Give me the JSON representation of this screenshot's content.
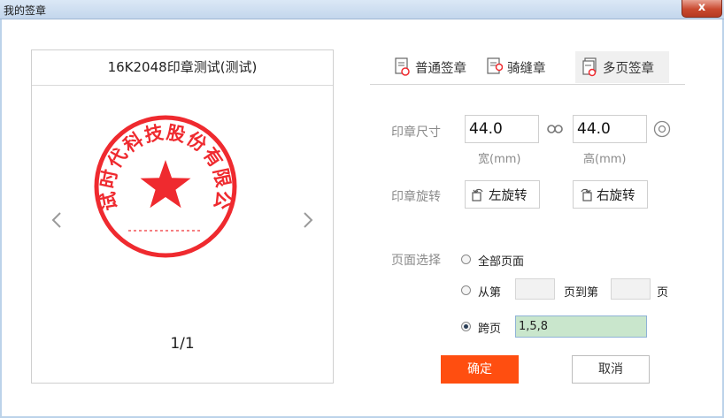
{
  "window": {
    "title": "我的签章",
    "close_label": "x"
  },
  "preview": {
    "seal_name": "16K2048印章测试(测试)",
    "seal_text": "测试时代科技股份有限公司",
    "page_counter": "1/1"
  },
  "tabs": [
    {
      "label": "普通签章"
    },
    {
      "label": "骑缝章"
    },
    {
      "label": "多页签章",
      "active": true
    }
  ],
  "size": {
    "label": "印章尺寸",
    "width_value": "44.0",
    "height_value": "44.0",
    "width_caption": "宽(mm)",
    "height_caption": "高(mm)"
  },
  "rotate": {
    "label": "印章旋转",
    "left_label": "左旋转",
    "right_label": "右旋转"
  },
  "pages": {
    "label": "页面选择",
    "all_label": "全部页面",
    "from_label": "从第",
    "to_label": "页到第",
    "page_suffix": "页",
    "skip_label": "跨页",
    "skip_value": "1,5,8",
    "selected": "skip"
  },
  "actions": {
    "ok_label": "确定",
    "cancel_label": "取消"
  },
  "colors": {
    "seal_red": "#ef2a2f",
    "ok_button": "#ff4e10",
    "skip_input_bg": "#c9e6cc"
  }
}
